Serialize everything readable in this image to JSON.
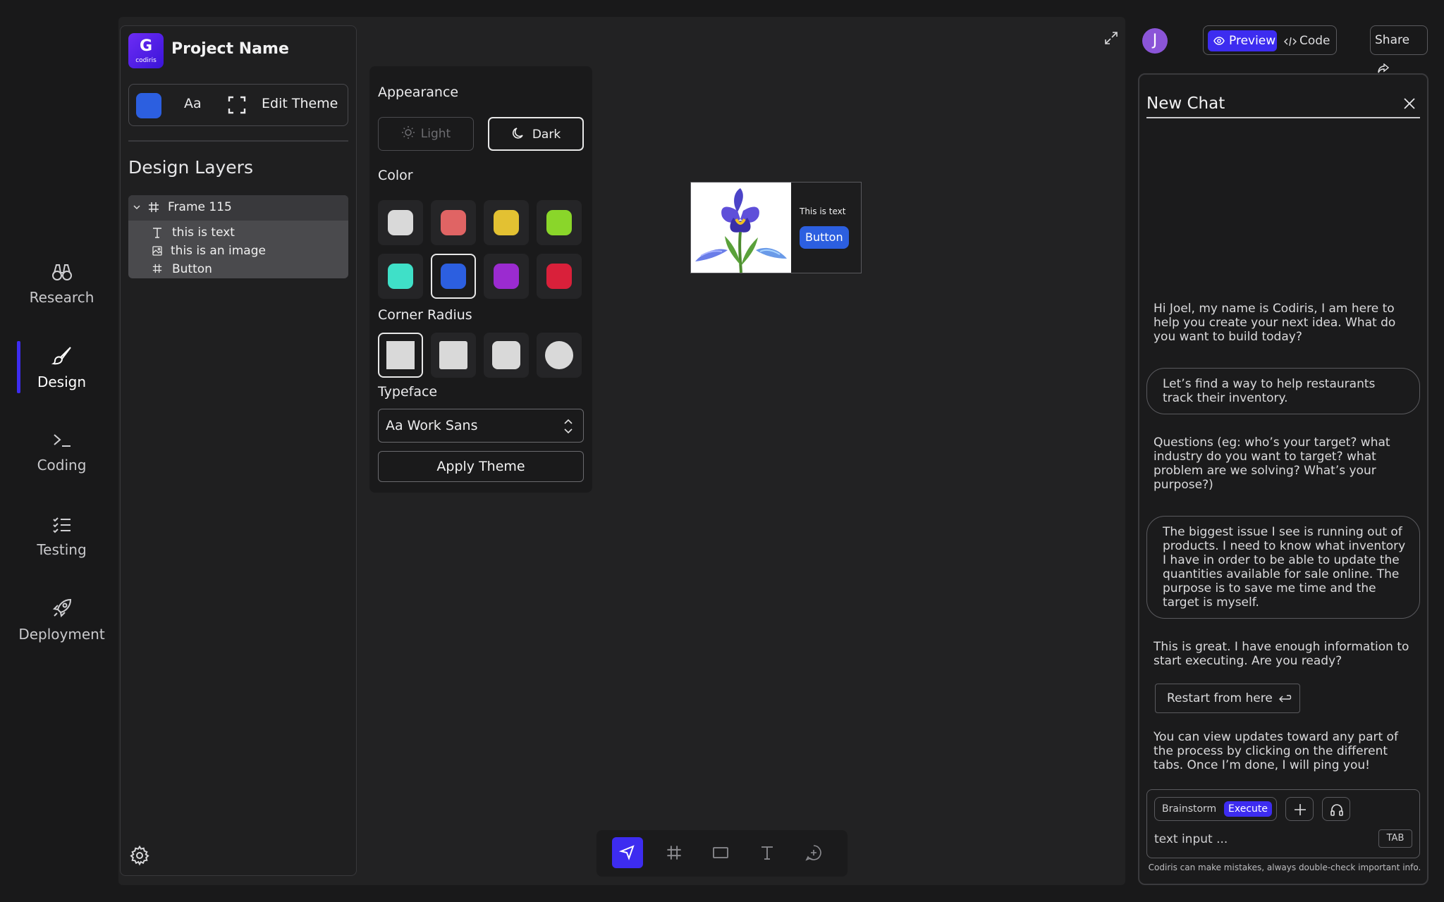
{
  "nav": {
    "items": [
      {
        "label": "Research",
        "icon": "binoculars-icon"
      },
      {
        "label": "Design",
        "icon": "brush-icon"
      },
      {
        "label": "Coding",
        "icon": "terminal-icon"
      },
      {
        "label": "Testing",
        "icon": "checklist-icon"
      },
      {
        "label": "Deployment",
        "icon": "rocket-icon"
      }
    ],
    "active": "Design",
    "accent": "#3d2cf0"
  },
  "project": {
    "logo_text": "codiris",
    "name": "Project Name"
  },
  "theme_toolbar": {
    "font_label": "Aa",
    "edit_label": "Edit Theme"
  },
  "layers": {
    "title": "Design Layers",
    "frame": "Frame 115",
    "children": [
      "this is text",
      "this is an image",
      "Button"
    ]
  },
  "theme_panel": {
    "appearance_title": "Appearance",
    "light_label": "Light",
    "dark_label": "Dark",
    "selected_mode": "Dark",
    "color_title": "Color",
    "colors": [
      "#d9d9d9",
      "#e06464",
      "#e3c132",
      "#8ad62a",
      "#3fe0c8",
      "#2c5fe0",
      "#9b2bd0",
      "#d9203a"
    ],
    "selected_color": "#2c5fe0",
    "radius_title": "Corner Radius",
    "typeface_title": "Typeface",
    "typeface_value": "Aa Work Sans",
    "apply_label": "Apply Theme"
  },
  "preview_card": {
    "text": "This is text",
    "button": "Button"
  },
  "topbar": {
    "avatar": "J",
    "preview_label": "Preview",
    "code_label": "Code",
    "share_label": "Share"
  },
  "chat": {
    "title": "New Chat",
    "messages": [
      {
        "role": "assistant",
        "text": "Hi Joel, my name is Codiris, I am here to help you create your next idea. What do you want to build today?"
      },
      {
        "role": "user",
        "text": "Let’s find a way to help restaurants track their inventory."
      },
      {
        "role": "assistant",
        "text": "Questions (eg: who’s your target? what industry do you want to target? what problem are we solving? What’s your purpose?)"
      },
      {
        "role": "user",
        "text": "The biggest issue I see is running out of products. I need to know what inventory I have in order to be able to update the quantities available for sale online. The purpose is to save me time and the target is myself."
      },
      {
        "role": "assistant",
        "text": "This is great. I have enough information to start executing. Are you ready?"
      },
      {
        "role": "assistant",
        "text": "You can view updates toward any part of the process by clicking on the different tabs. Once I’m done, I will ping you!"
      }
    ],
    "restart_label": "Restart from here",
    "mode_brainstorm": "Brainstorm",
    "mode_execute": "Execute",
    "input_placeholder": "text input ...",
    "tab_hint": "TAB",
    "disclaimer": "Codiris can make mistakes, always double-check important info."
  }
}
